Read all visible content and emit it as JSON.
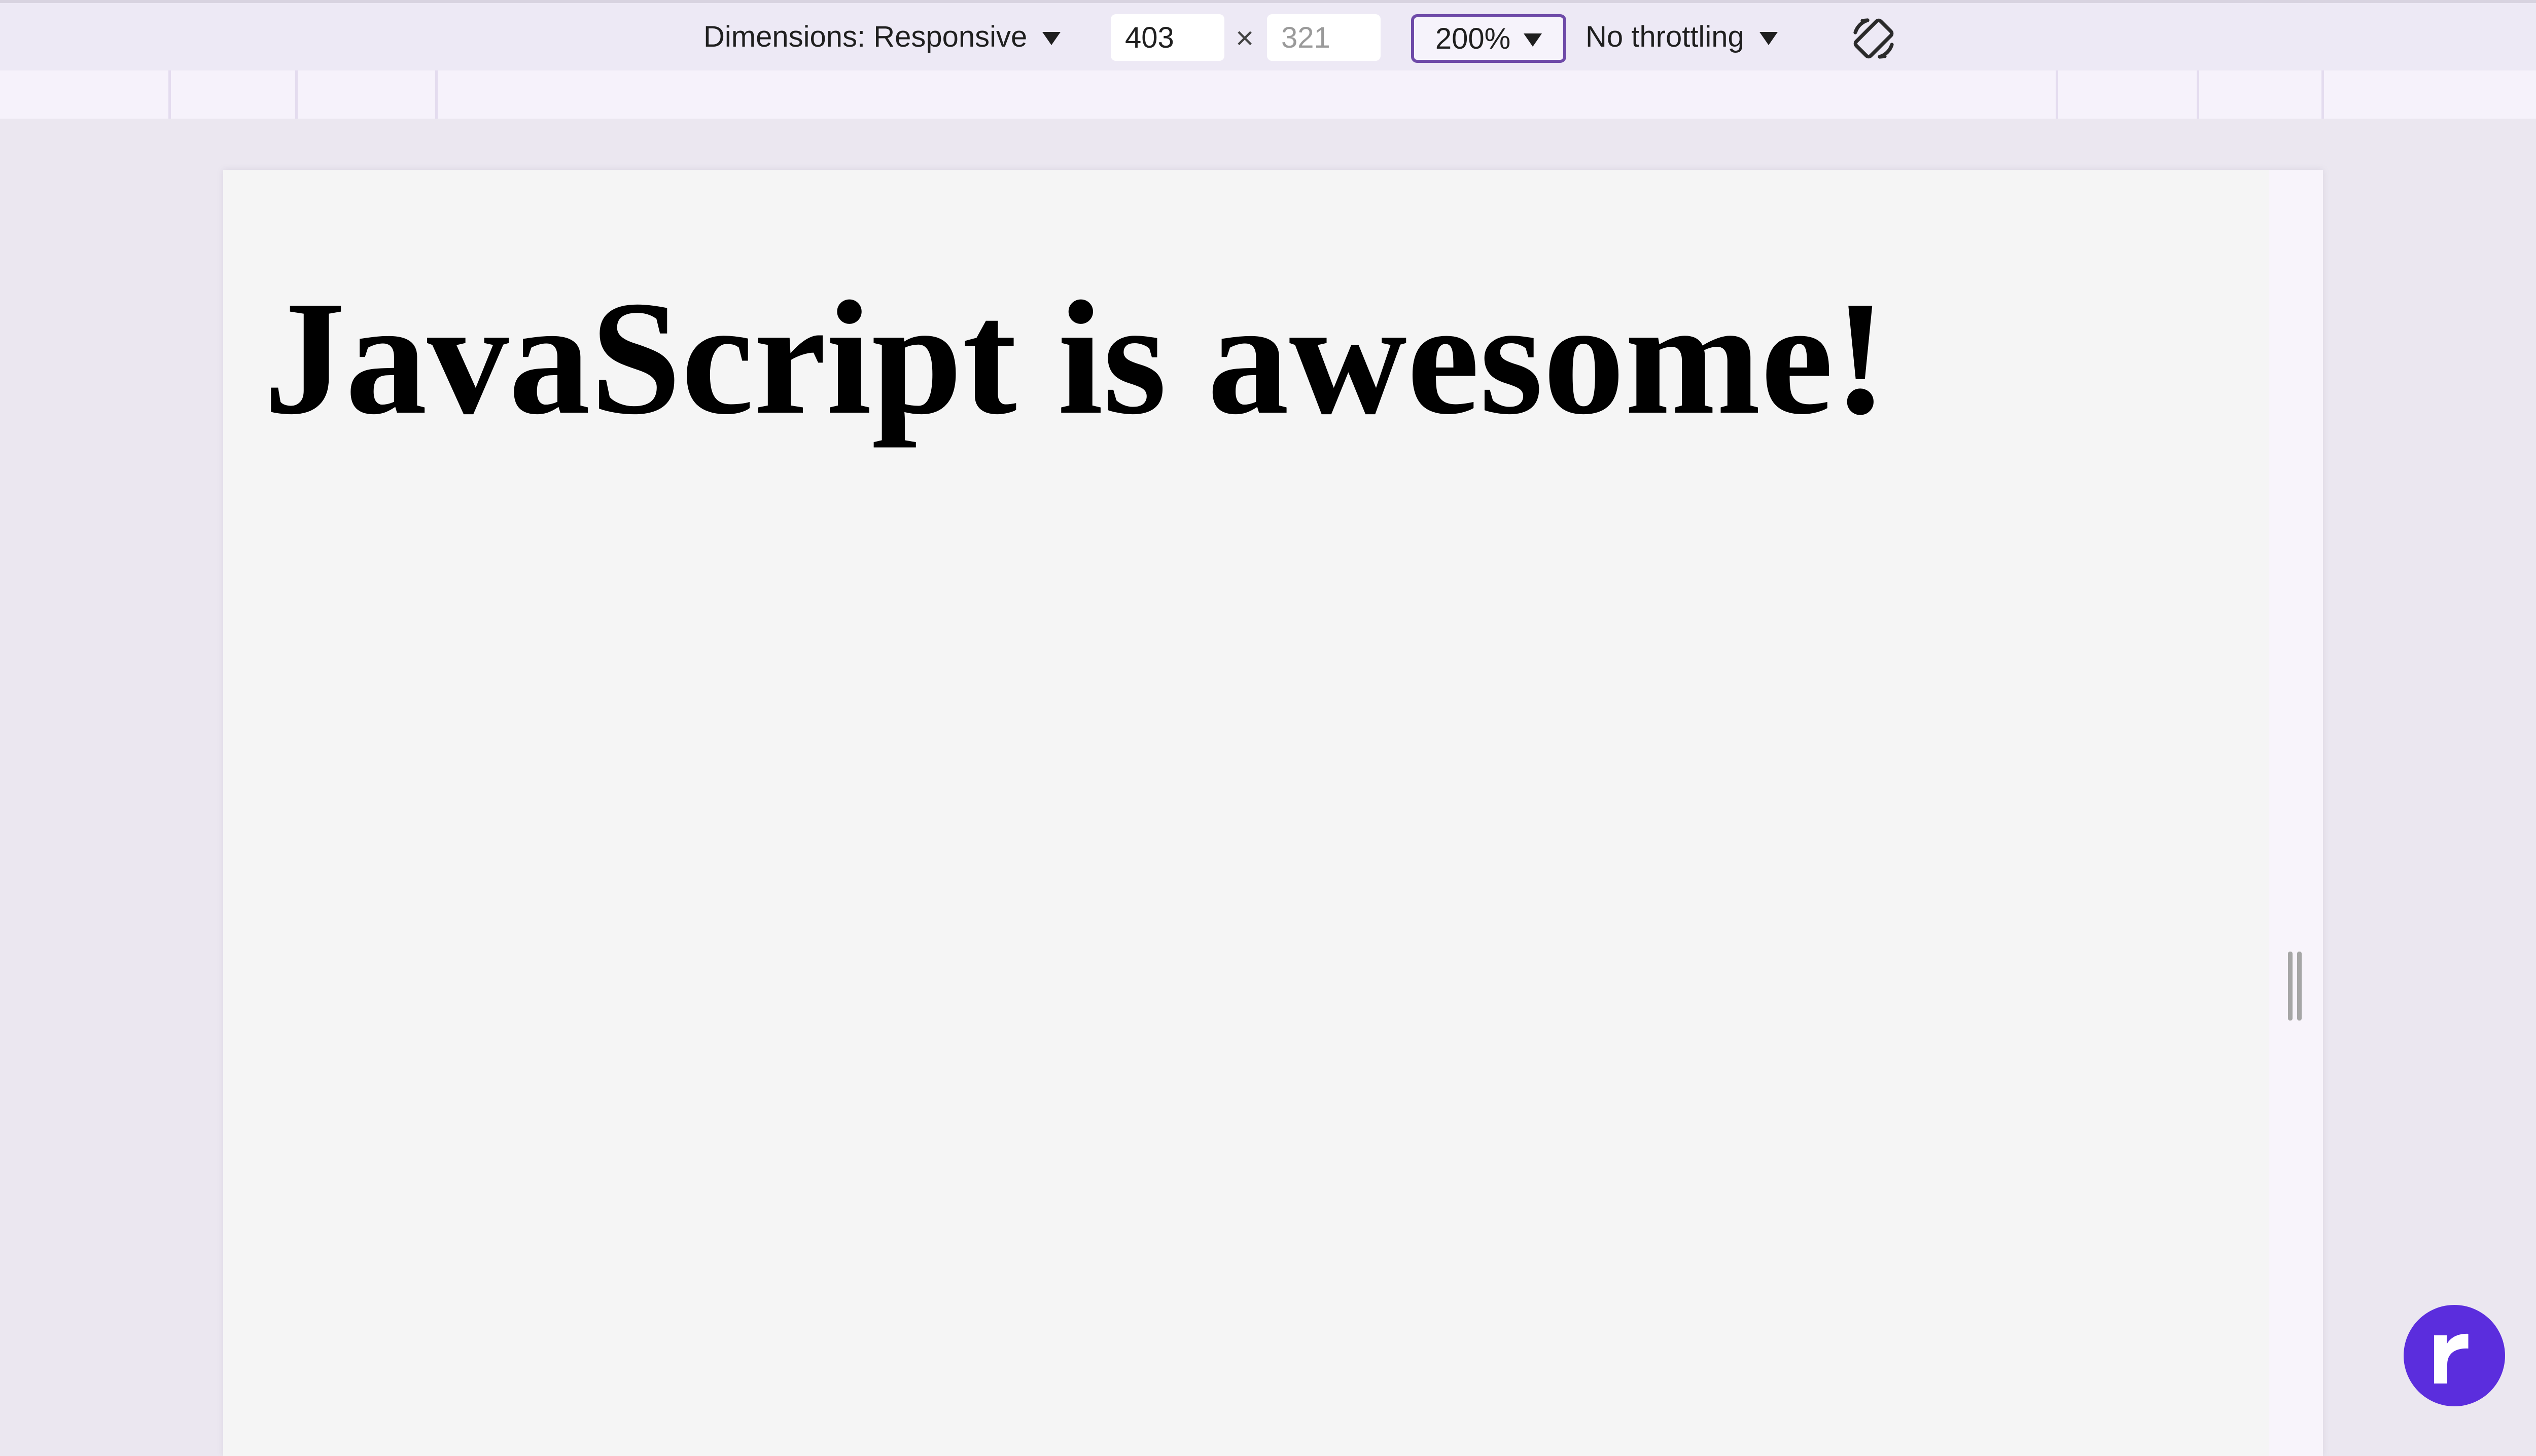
{
  "toolbar": {
    "dimensions_label": "Dimensions: Responsive",
    "width_value": "403",
    "times_symbol": "×",
    "height_value": "321",
    "zoom_value": "200%",
    "throttling_label": "No throttling"
  },
  "viewport": {
    "heading": "JavaScript is awesome!"
  },
  "colors": {
    "accent": "#6e4aa8",
    "badge": "#5b2ddd"
  },
  "icons": {
    "rotate": "rotate-icon",
    "badge": "r-logo-icon"
  }
}
